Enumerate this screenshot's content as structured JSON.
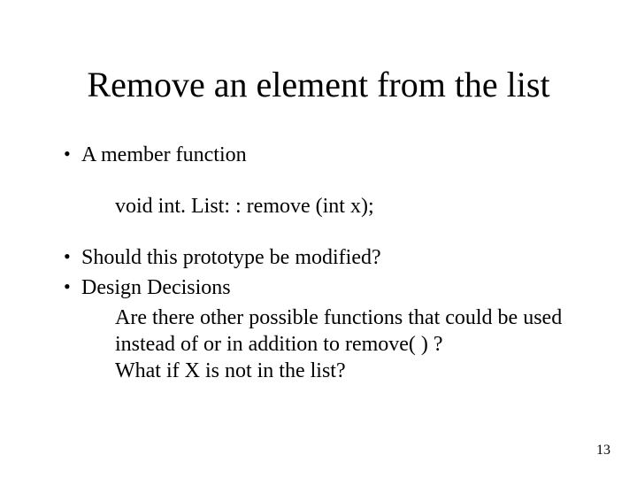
{
  "title": "Remove an element from the list",
  "bullets": {
    "b1": "A member function",
    "code": "void int. List: : remove (int x);",
    "b2": "Should this prototype be modified?",
    "b3": "Design Decisions",
    "sub1": "Are there other possible functions that could be used instead of or in addition to remove( ) ?",
    "sub2": "What if X is not in the list?"
  },
  "page_number": "13",
  "bullet_char": "•"
}
